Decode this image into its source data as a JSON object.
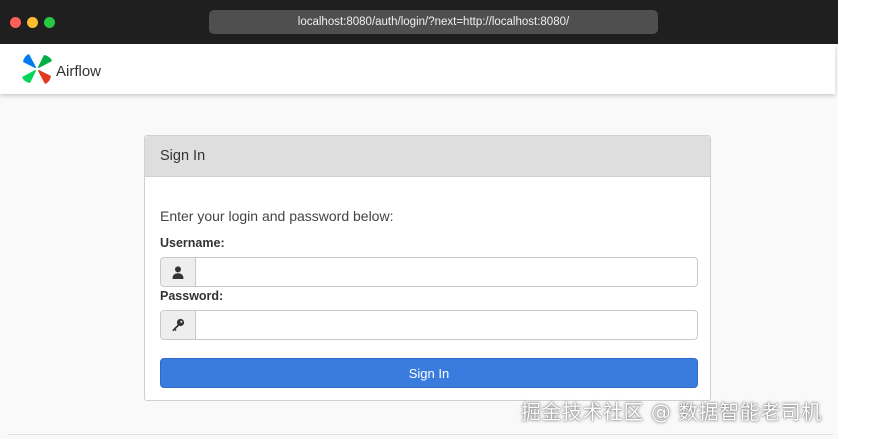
{
  "browser": {
    "url": "localhost:8080/auth/login/?next=http://localhost:8080/",
    "traffic_light_colors": [
      "#fe5f57",
      "#febc2e",
      "#28c840"
    ]
  },
  "navbar": {
    "brand_name": "Airflow",
    "logo_icon": "pinwheel-logo-icon"
  },
  "login_panel": {
    "heading": "Sign In",
    "intro": "Enter your login and password below:",
    "username_label": "Username:",
    "username_value": "",
    "username_icon": "user-icon",
    "password_label": "Password:",
    "password_value": "",
    "password_icon": "key-icon",
    "submit_label": "Sign In",
    "accent_color": "#3a7bde"
  },
  "watermark": "掘金技术社区 @ 数据智能老司机"
}
